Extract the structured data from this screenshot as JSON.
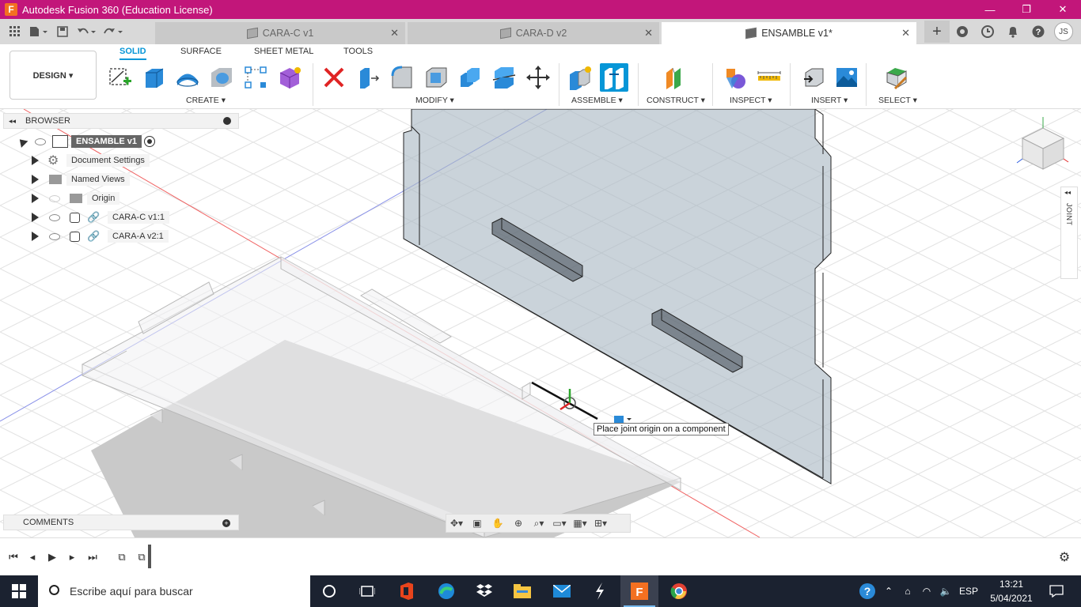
{
  "window": {
    "title": "Autodesk Fusion 360 (Education License)",
    "app_icon": "F",
    "minimize": "—",
    "restore": "❐",
    "close": "✕"
  },
  "tabs": [
    {
      "label": "CARA-C v1",
      "active": false
    },
    {
      "label": "CARA-D v2",
      "active": false
    },
    {
      "label": "ENSAMBLE v1*",
      "active": true
    }
  ],
  "user_initials": "JS",
  "workspace": "DESIGN ▾",
  "ribbon_tabs": [
    "SOLID",
    "SURFACE",
    "SHEET METAL",
    "TOOLS"
  ],
  "groups": {
    "create": "CREATE ▾",
    "modify": "MODIFY ▾",
    "assemble": "ASSEMBLE ▾",
    "construct": "CONSTRUCT ▾",
    "inspect": "INSPECT ▾",
    "insert": "INSERT ▾",
    "select": "SELECT ▾"
  },
  "browser": {
    "title": "BROWSER",
    "root": "ENSAMBLE v1",
    "items": [
      {
        "label": "Document Settings",
        "icon": "gear-icon"
      },
      {
        "label": "Named Views",
        "icon": "folder-icon"
      },
      {
        "label": "Origin",
        "icon": "folder-icon"
      },
      {
        "label": "CARA-C v1:1",
        "icon": "component-icon"
      },
      {
        "label": "CARA-A v2:1",
        "icon": "component-icon"
      }
    ]
  },
  "comments": {
    "title": "COMMENTS"
  },
  "joint_panel": {
    "label": "JOINT"
  },
  "tooltip": "Place joint origin on a component",
  "taskbar": {
    "search_placeholder": "Escribe aquí para buscar",
    "language": "ESP",
    "time": "13:21",
    "date": "5/04/2021"
  },
  "colors": {
    "titlebar": "#c2167a",
    "accent": "#0696d7",
    "taskbar": "#1b2230"
  }
}
